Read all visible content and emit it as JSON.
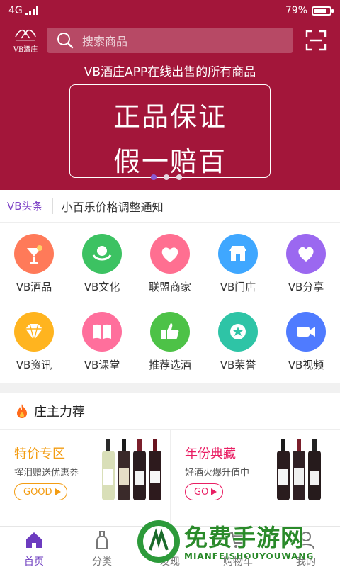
{
  "status_bar": {
    "network": "4G",
    "battery": "79%",
    "battery_level": 0.79
  },
  "header": {
    "logo_text": "VB酒庄",
    "search_placeholder": "搜索商品"
  },
  "banner": {
    "caption": "VB酒庄APP在线出售的所有商品",
    "line1": "正品保证",
    "line2": "假一赔百",
    "slide_count": 3,
    "active_slide": 1
  },
  "news": {
    "tag": "VB头条",
    "text": "小百乐价格调整通知"
  },
  "grid": [
    {
      "label": "VB酒品",
      "icon": "cocktail-icon",
      "color": "#ff7a59"
    },
    {
      "label": "VB文化",
      "icon": "globe-hands-icon",
      "color": "#3cc262"
    },
    {
      "label": "联盟商家",
      "icon": "handshake-heart-icon",
      "color": "#ff6f91"
    },
    {
      "label": "VB门店",
      "icon": "store-icon",
      "color": "#3fa7ff"
    },
    {
      "label": "VB分享",
      "icon": "heart-icon",
      "color": "#9b68f0"
    },
    {
      "label": "VB资讯",
      "icon": "diamond-icon",
      "color": "#ffb41f"
    },
    {
      "label": "VB课堂",
      "icon": "book-icon",
      "color": "#ff6f9c"
    },
    {
      "label": "推荐选酒",
      "icon": "thumbs-up-icon",
      "color": "#4dc247"
    },
    {
      "label": "VB荣誉",
      "icon": "medal-icon",
      "color": "#2ec4a6"
    },
    {
      "label": "VB视频",
      "icon": "video-icon",
      "color": "#4f7bff"
    }
  ],
  "section": {
    "title": "庄主力荐",
    "icon": "flame-icon"
  },
  "cards": [
    {
      "title": "特价专区",
      "subtitle": "挥泪赠送优惠券",
      "button": "GOOD",
      "color": "#f39c12"
    },
    {
      "title": "年份典藏",
      "subtitle": "好酒火爆升值中",
      "button": "GO",
      "color": "#e91e63"
    }
  ],
  "tabs": [
    {
      "label": "首页",
      "icon": "home-icon",
      "active": true
    },
    {
      "label": "分类",
      "icon": "bottle-icon",
      "active": false
    },
    {
      "label": "发现",
      "icon": "compass-icon",
      "active": false
    },
    {
      "label": "购物车",
      "icon": "cart-icon",
      "active": false
    },
    {
      "label": "我的",
      "icon": "user-icon",
      "active": false
    }
  ],
  "watermark": {
    "title": "免费手游网",
    "url": "MIANFEISHOUYOUWANG"
  }
}
